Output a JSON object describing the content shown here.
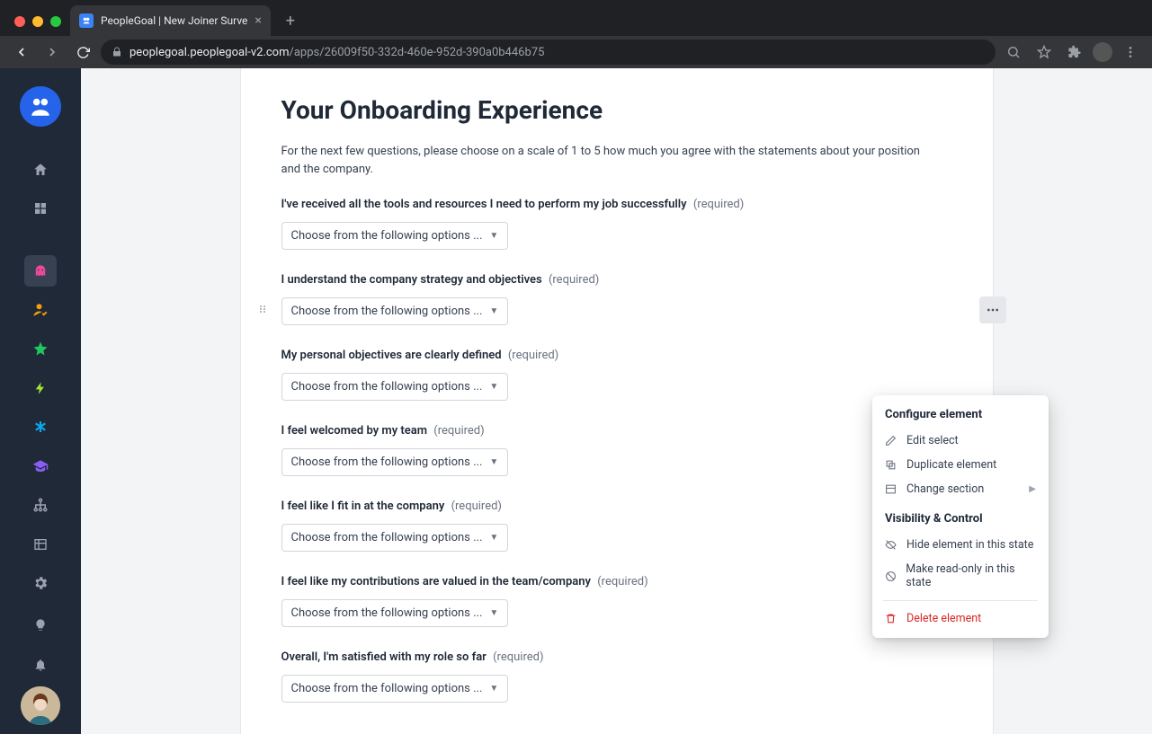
{
  "browser": {
    "tab_title": "PeopleGoal | New Joiner Surve",
    "url_host": "peoplegoal.peoplegoal-v2.com",
    "url_path": "/apps/26009f50-332d-460e-952d-390a0b446b75"
  },
  "page": {
    "title": "Your Onboarding Experience",
    "intro": "For the next few questions, please choose on a scale of 1 to 5 how much you agree with the statements about your position and the company.",
    "required_label": "(required)",
    "select_placeholder": "Choose from the following options ...",
    "questions": [
      {
        "label": "I've received all the tools and resources I need to perform my job successfully"
      },
      {
        "label": "I understand the company strategy and objectives"
      },
      {
        "label": "My personal objectives are clearly defined"
      },
      {
        "label": "I feel welcomed by my team"
      },
      {
        "label": "I feel like I fit in at the company"
      },
      {
        "label": "I feel like my contributions are valued in the team/company"
      },
      {
        "label": "Overall, I'm satisfied with my role so far"
      }
    ]
  },
  "popover": {
    "section1_title": "Configure element",
    "edit": "Edit select",
    "duplicate": "Duplicate element",
    "change_section": "Change section",
    "section2_title": "Visibility & Control",
    "hide": "Hide element in this state",
    "readonly": "Make read-only in this state",
    "delete": "Delete element"
  }
}
